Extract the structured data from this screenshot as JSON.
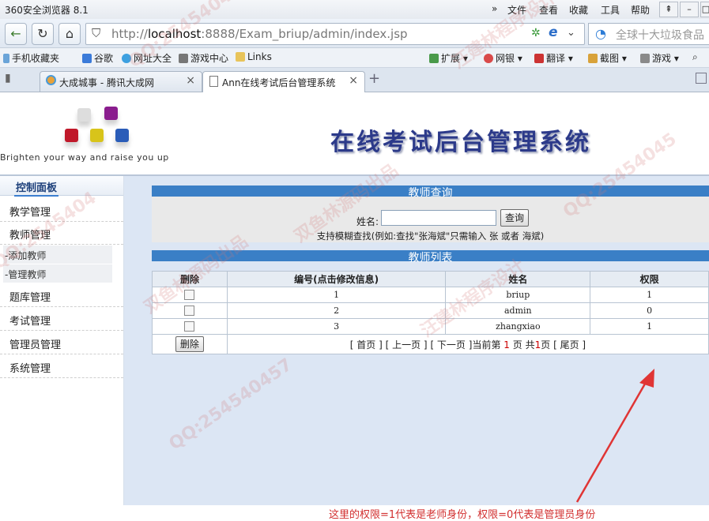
{
  "browser": {
    "title": "360安全浏览器 8.1",
    "menu": [
      "文件",
      "查看",
      "收藏",
      "工具",
      "帮助"
    ],
    "url_prefix": "http://",
    "url_host": "localhost",
    "url_rest": ":8888/Exam_briup/admin/index.jsp",
    "search_placeholder": "全球十大垃圾食品",
    "bookmarks": [
      "手机收藏夹",
      "谷歌",
      "网址大全",
      "游戏中心",
      "Links",
      "扩展",
      "网银",
      "翻译",
      "截图",
      "游戏"
    ],
    "tabs": [
      {
        "label": "大成城事 - 腾讯大成网"
      },
      {
        "label": "Ann在线考试后台管理系统"
      }
    ]
  },
  "header": {
    "slogan": "Brighten your way and raise you up",
    "system_title": "在线考试后台管理系统"
  },
  "sidebar": {
    "panel_title": "控制面板",
    "items": [
      {
        "label": "教学管理"
      },
      {
        "label": "教师管理"
      },
      {
        "label": "-添加教师"
      },
      {
        "label": "-管理教师"
      },
      {
        "label": "题库管理"
      },
      {
        "label": "考试管理"
      },
      {
        "label": "管理员管理"
      },
      {
        "label": "系统管理"
      }
    ]
  },
  "query": {
    "section_title": "教师查询",
    "name_label": "姓名:",
    "name_value": "",
    "button": "查询",
    "hint": "支持模糊查找(例如:查找\"张海斌\"只需输入 张  或者  海斌)"
  },
  "list": {
    "section_title": "教师列表",
    "columns": [
      "删除",
      "编号(点击修改信息)",
      "姓名",
      "权限"
    ],
    "rows": [
      {
        "id": "1",
        "name": "briup",
        "perm": "1"
      },
      {
        "id": "2",
        "name": "admin",
        "perm": "0"
      },
      {
        "id": "3",
        "name": "zhangxiao",
        "perm": "1"
      }
    ],
    "delete_button": "删除",
    "pager": {
      "first": "[ 首页 ]",
      "prev": "[ 上一页 ]",
      "next": "[ 下一页 ]",
      "current_prefix": "当前第",
      "current": "1",
      "current_suffix": "页",
      "total_prefix": "共",
      "total": "1",
      "total_suffix": "页",
      "last": "[ 尾页 ]"
    }
  },
  "annotation": "这里的权限=1代表是老师身份，权限=0代表是管理员身份",
  "watermarks": [
    "QQ:25454045",
    "双鱼林源码出品",
    "汪建林程序设计",
    "QQ:2545404",
    "双鱼林源码出品",
    "汪建林程序设计",
    "QQ:25454045",
    "QQ:254540457"
  ],
  "colors": {
    "accent": "#3a7fc6",
    "title": "#2c3a8a",
    "annotation": "#d23030",
    "main_bg": "#dce6f4"
  }
}
